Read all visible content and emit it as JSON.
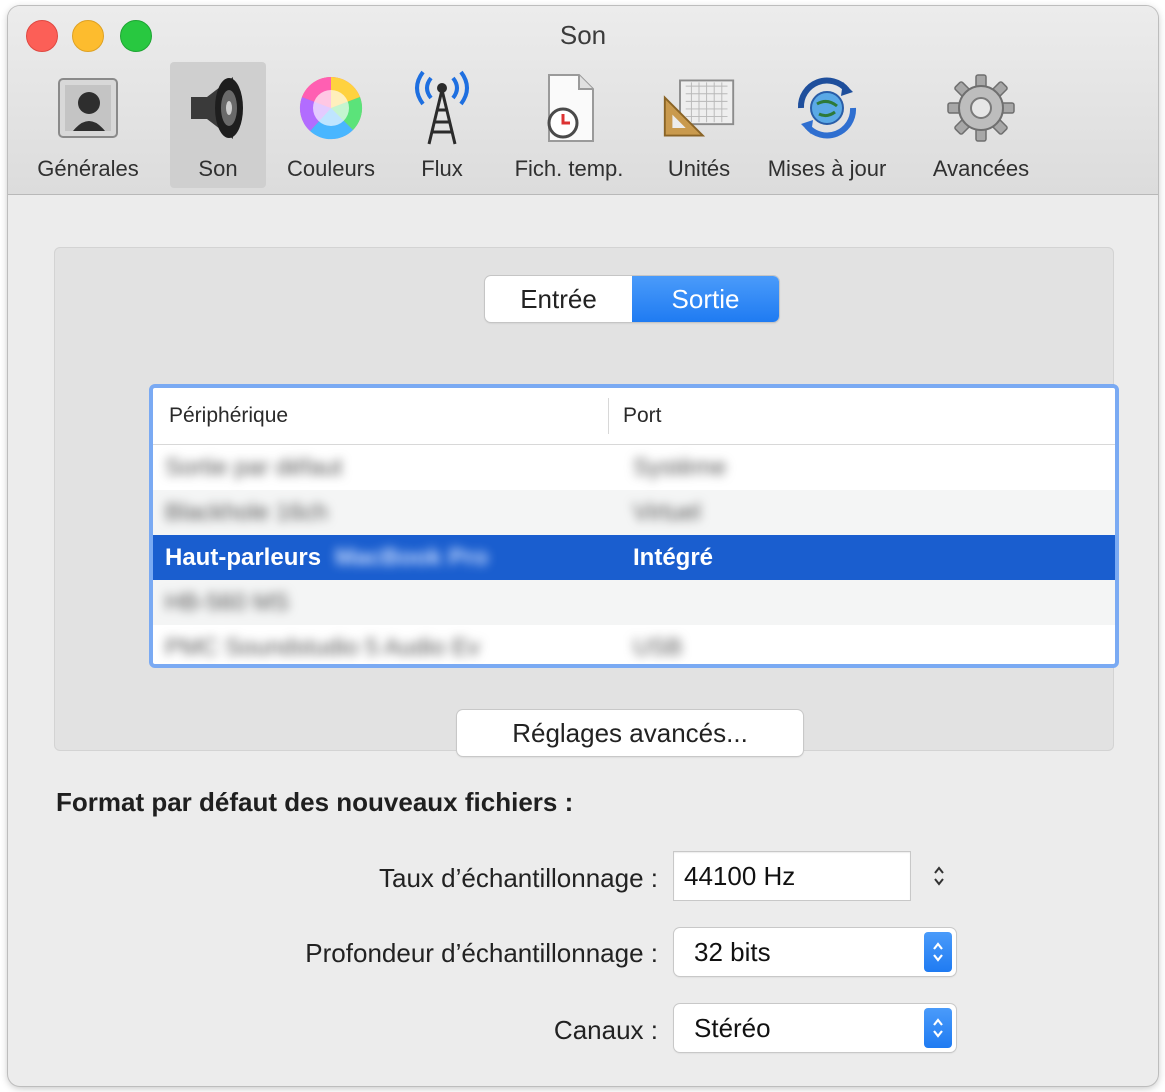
{
  "window": {
    "title": "Son"
  },
  "toolbar": {
    "items": [
      {
        "label": "Générales",
        "icon": "general-icon"
      },
      {
        "label": "Son",
        "icon": "speaker-icon",
        "selected": true
      },
      {
        "label": "Couleurs",
        "icon": "color-wheel-icon"
      },
      {
        "label": "Flux",
        "icon": "antenna-icon"
      },
      {
        "label": "Fich. temp.",
        "icon": "temp-file-icon"
      },
      {
        "label": "Unités",
        "icon": "ruler-icon"
      },
      {
        "label": "Mises à jour",
        "icon": "update-globe-icon"
      },
      {
        "label": "Avancées",
        "icon": "gear-icon"
      }
    ]
  },
  "segmented": {
    "input_label": "Entrée",
    "output_label": "Sortie",
    "selected": "Sortie"
  },
  "device_table": {
    "columns": [
      "Périphérique",
      "Port"
    ],
    "rows": [
      {
        "device": "Sortie par défaut",
        "port": "Système",
        "blurred": true
      },
      {
        "device": "Blackhole 16ch",
        "port": "Virtuel",
        "blurred": true
      },
      {
        "device": "Haut-parleurs",
        "device_blurred_suffix": "MacBook Pro",
        "port": "Intégré",
        "selected": true
      },
      {
        "device": "HB-560 MS",
        "port": "",
        "blurred": true
      },
      {
        "device": "PMC Soundstudio 5 Audio Ev",
        "port": "USB",
        "blurred": true
      }
    ]
  },
  "advanced_button": {
    "label": "Réglages avancés..."
  },
  "format": {
    "title": "Format par défaut des nouveaux fichiers :",
    "sample_rate_label": "Taux d’échantillonnage :",
    "sample_rate_value": "44100 Hz",
    "bit_depth_label": "Profondeur d’échantillonnage :",
    "bit_depth_value": "32 bits",
    "channels_label": "Canaux :",
    "channels_value": "Stéréo"
  },
  "colors": {
    "accent": "#1f7bf2",
    "selection": "#1a5ecf",
    "focus_ring": "#7aaaf3"
  }
}
